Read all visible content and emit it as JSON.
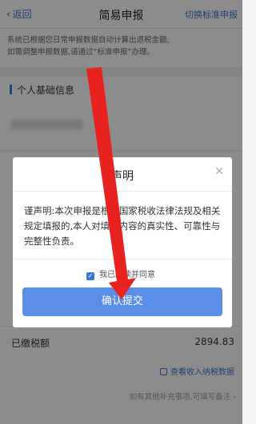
{
  "nav": {
    "back_label": "返回",
    "title": "简易申报",
    "switch_label": "切换标准申报"
  },
  "notice": {
    "line1": "系统已根据您日常申报数据自动计算出退税金额;",
    "line2": "如需调整申报数据,请通过“标准申报”办理。"
  },
  "section": {
    "title": "个人基础信息"
  },
  "tax_row": {
    "label": "已缴税额",
    "value": "2894.83"
  },
  "links": {
    "detail": "查看收入纳税数据",
    "footer_hint": "如有其他补充事项,可填写备注 ›"
  },
  "dialog": {
    "title": "声明",
    "close_glyph": "✕",
    "body": "谨声明:本次申报是根据国家税收法律法规及相关规定填报的,本人对填报内容的真实性、可靠性与完整性负责。",
    "agree_label": "我已阅读并同意",
    "confirm_label": "确认提交"
  },
  "colors": {
    "accent": "#3a78d8",
    "button": "#5b8ee6",
    "arrow": "#e8221f"
  }
}
